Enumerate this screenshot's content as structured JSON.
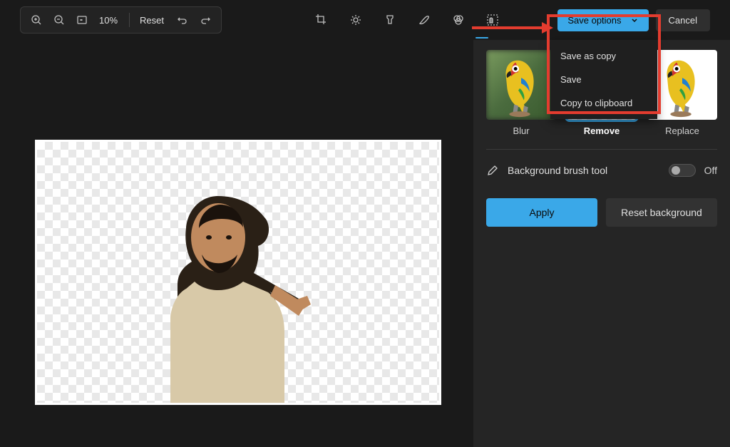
{
  "toolbar": {
    "zoom_level": "10%",
    "reset_label": "Reset",
    "save_options_label": "Save options",
    "cancel_label": "Cancel"
  },
  "dropdown": {
    "items": [
      {
        "label": "Save as copy"
      },
      {
        "label": "Save"
      },
      {
        "label": "Copy to clipboard"
      }
    ]
  },
  "panel": {
    "thumbs": [
      {
        "label": "Blur"
      },
      {
        "label": "Remove"
      },
      {
        "label": "Replace"
      }
    ],
    "brush_tool_label": "Background brush tool",
    "toggle_state_label": "Off",
    "apply_label": "Apply",
    "reset_bg_label": "Reset background"
  },
  "colors": {
    "accent": "#3aa8e8",
    "annotation": "#e33c2f"
  }
}
